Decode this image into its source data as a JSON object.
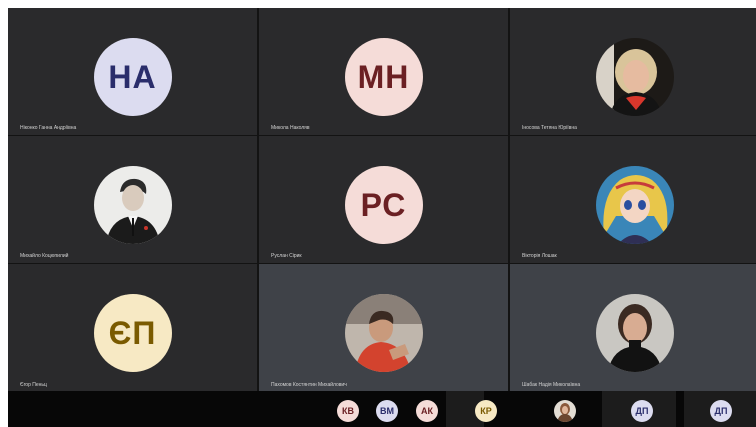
{
  "tiles": [
    {
      "name": "Ніконко Ганна Андріївна",
      "initials": "НА",
      "bg": "#dcdcf0",
      "fg": "#2a2d6b",
      "kind": "initials"
    },
    {
      "name": "Микола Наколяв",
      "initials": "МН",
      "bg": "#f5dcd8",
      "fg": "#6b2023",
      "kind": "initials"
    },
    {
      "name": "Іносова Тетяна Юріївна",
      "initials": "",
      "kind": "photo",
      "icon": "woman-photo-avatar"
    },
    {
      "name": "Михайло Коцюпилий",
      "initials": "",
      "kind": "photo",
      "icon": "man-in-suit-photo-avatar"
    },
    {
      "name": "Руслан Сірик",
      "initials": "РС",
      "bg": "#f5dcd8",
      "fg": "#6b2023",
      "kind": "initials"
    },
    {
      "name": "Вікторія Лошак",
      "initials": "",
      "kind": "photo",
      "icon": "anime-illustration-avatar"
    },
    {
      "name": "Єгор Пеньц",
      "initials": "ЄП",
      "bg": "#f7e9c4",
      "fg": "#7a5a00",
      "kind": "initials"
    },
    {
      "name": "Пахомов Костянтин Михайлович",
      "initials": "",
      "kind": "photo",
      "icon": "man-red-shirt-photo-avatar"
    },
    {
      "name": "Шабак Надія Миколаївна",
      "initials": "",
      "kind": "photo",
      "icon": "woman-dark-hair-photo-avatar"
    }
  ],
  "bottom_participants": [
    {
      "initials": "КВ",
      "bg": "#f5dcd8",
      "fg": "#6b2023"
    },
    {
      "initials": "ВМ",
      "bg": "#dcdcf0",
      "fg": "#2a2d6b"
    },
    {
      "initials": "АК",
      "bg": "#f5dcd8",
      "fg": "#6b2023"
    },
    {
      "initials": "КР",
      "bg": "#f7e9c4",
      "fg": "#7a5a00"
    },
    {
      "initials": "",
      "icon": "small-photo-avatar"
    },
    {
      "initials": "ДП",
      "bg": "#dcdcf0",
      "fg": "#2a2d6b"
    },
    {
      "initials": "ДП",
      "bg": "#dcdcf0",
      "fg": "#2a2d6b"
    }
  ],
  "colors": {
    "tile": "#2a2a2c",
    "active_speaker_tile": "#3f4248",
    "background": "#131313",
    "bottom_bar": "#070707"
  }
}
